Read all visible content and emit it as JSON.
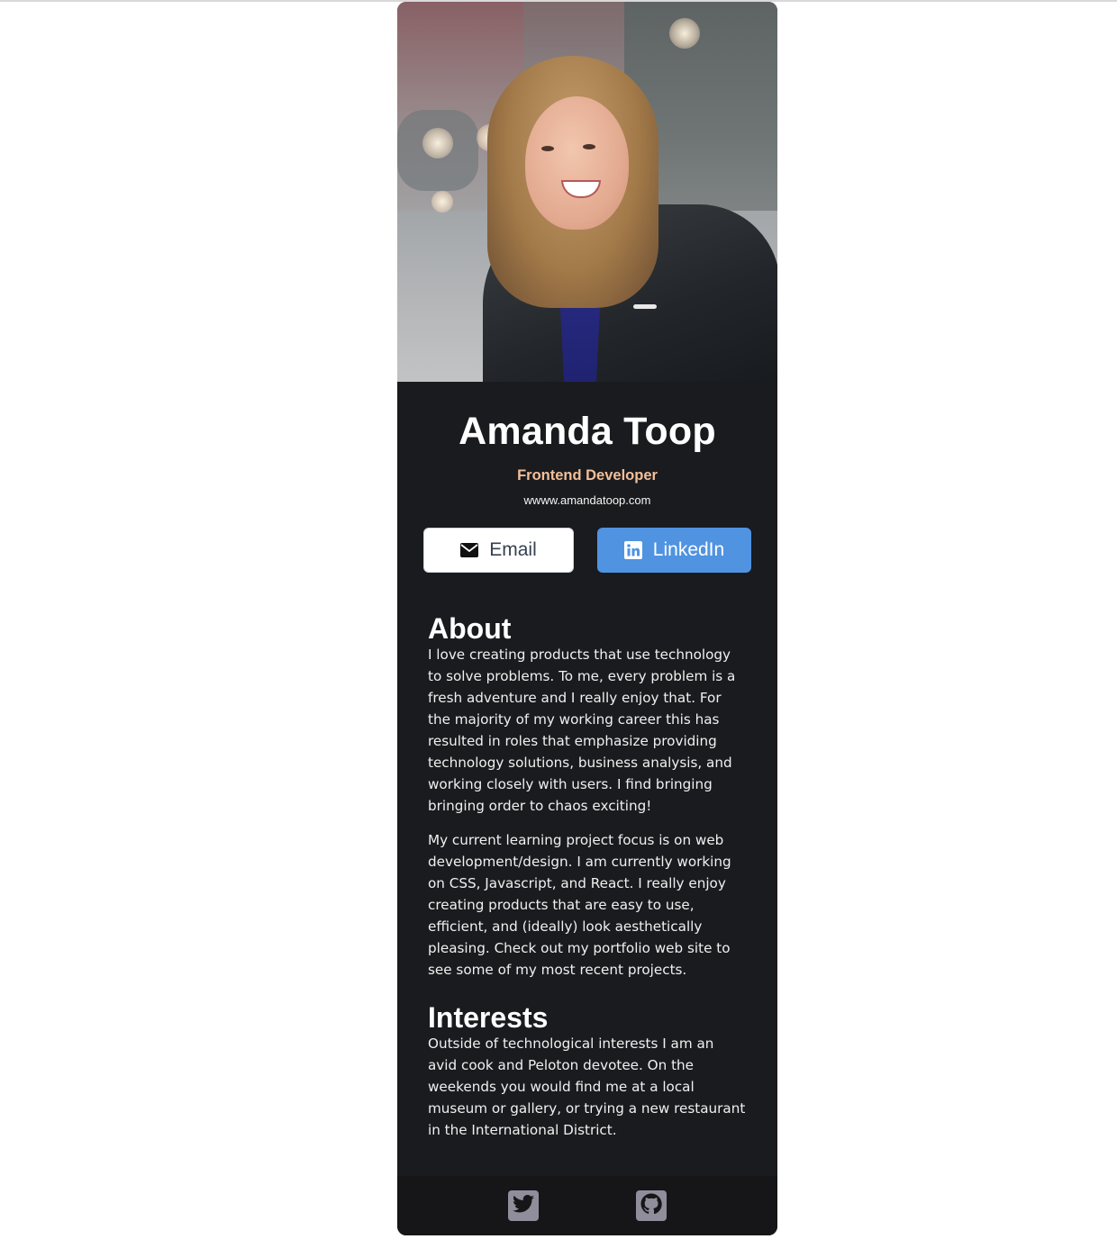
{
  "profile": {
    "name": "Amanda Toop",
    "role": "Frontend Developer",
    "website": "wwww.amandatoop.com",
    "photo_icon": "profile-photo"
  },
  "buttons": {
    "email_label": "Email",
    "email_icon": "envelope-icon",
    "linkedin_label": "LinkedIn",
    "linkedin_icon": "linkedin-icon"
  },
  "about": {
    "heading": "About",
    "paragraphs": [
      "I love creating products that use technology to solve problems. To me, every problem is a fresh adventure and I really enjoy that. For the majority of my working career this has resulted in roles that emphasize providing technology solutions, business analysis, and working closely with users. I find bringing bringing order to chaos exciting!",
      "My current learning project focus is on web development/design. I am currently working on CSS, Javascript, and React. I really enjoy creating products that are easy to use, efficient, and (ideally) look aesthetically pleasing. Check out my portfolio web site to see some of my most recent projects."
    ]
  },
  "interests": {
    "heading": "Interests",
    "text": "Outside of technological interests I am an avid cook and Peloton devotee. On the weekends you would find me at a local museum or gallery, or trying a new restaurant in the International District."
  },
  "footer": {
    "icons": [
      "twitter-icon",
      "github-icon"
    ]
  },
  "colors": {
    "card_bg": "#1a1b1e",
    "footer_bg": "#161619",
    "accent_role": "#f3bf99",
    "linkedin_blue": "#5093e1",
    "social_icon_bg": "#918e9b"
  }
}
